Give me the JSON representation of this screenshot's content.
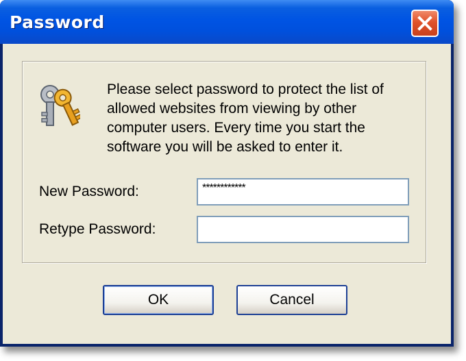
{
  "window": {
    "title": "Password",
    "close_icon": "close-icon"
  },
  "message": "Please select password to protect the list of allowed websites from viewing by other computer users. Every time you start the software you will be asked to enter it.",
  "icon": "keys-icon",
  "fields": {
    "new_password_label": "New Password:",
    "new_password_value": "************",
    "retype_password_label": "Retype Password:",
    "retype_password_value": ""
  },
  "buttons": {
    "ok": "OK",
    "cancel": "Cancel"
  },
  "colors": {
    "titlebar": "#0054e3",
    "close_button": "#e0522a",
    "client_background": "#ece9d8"
  }
}
